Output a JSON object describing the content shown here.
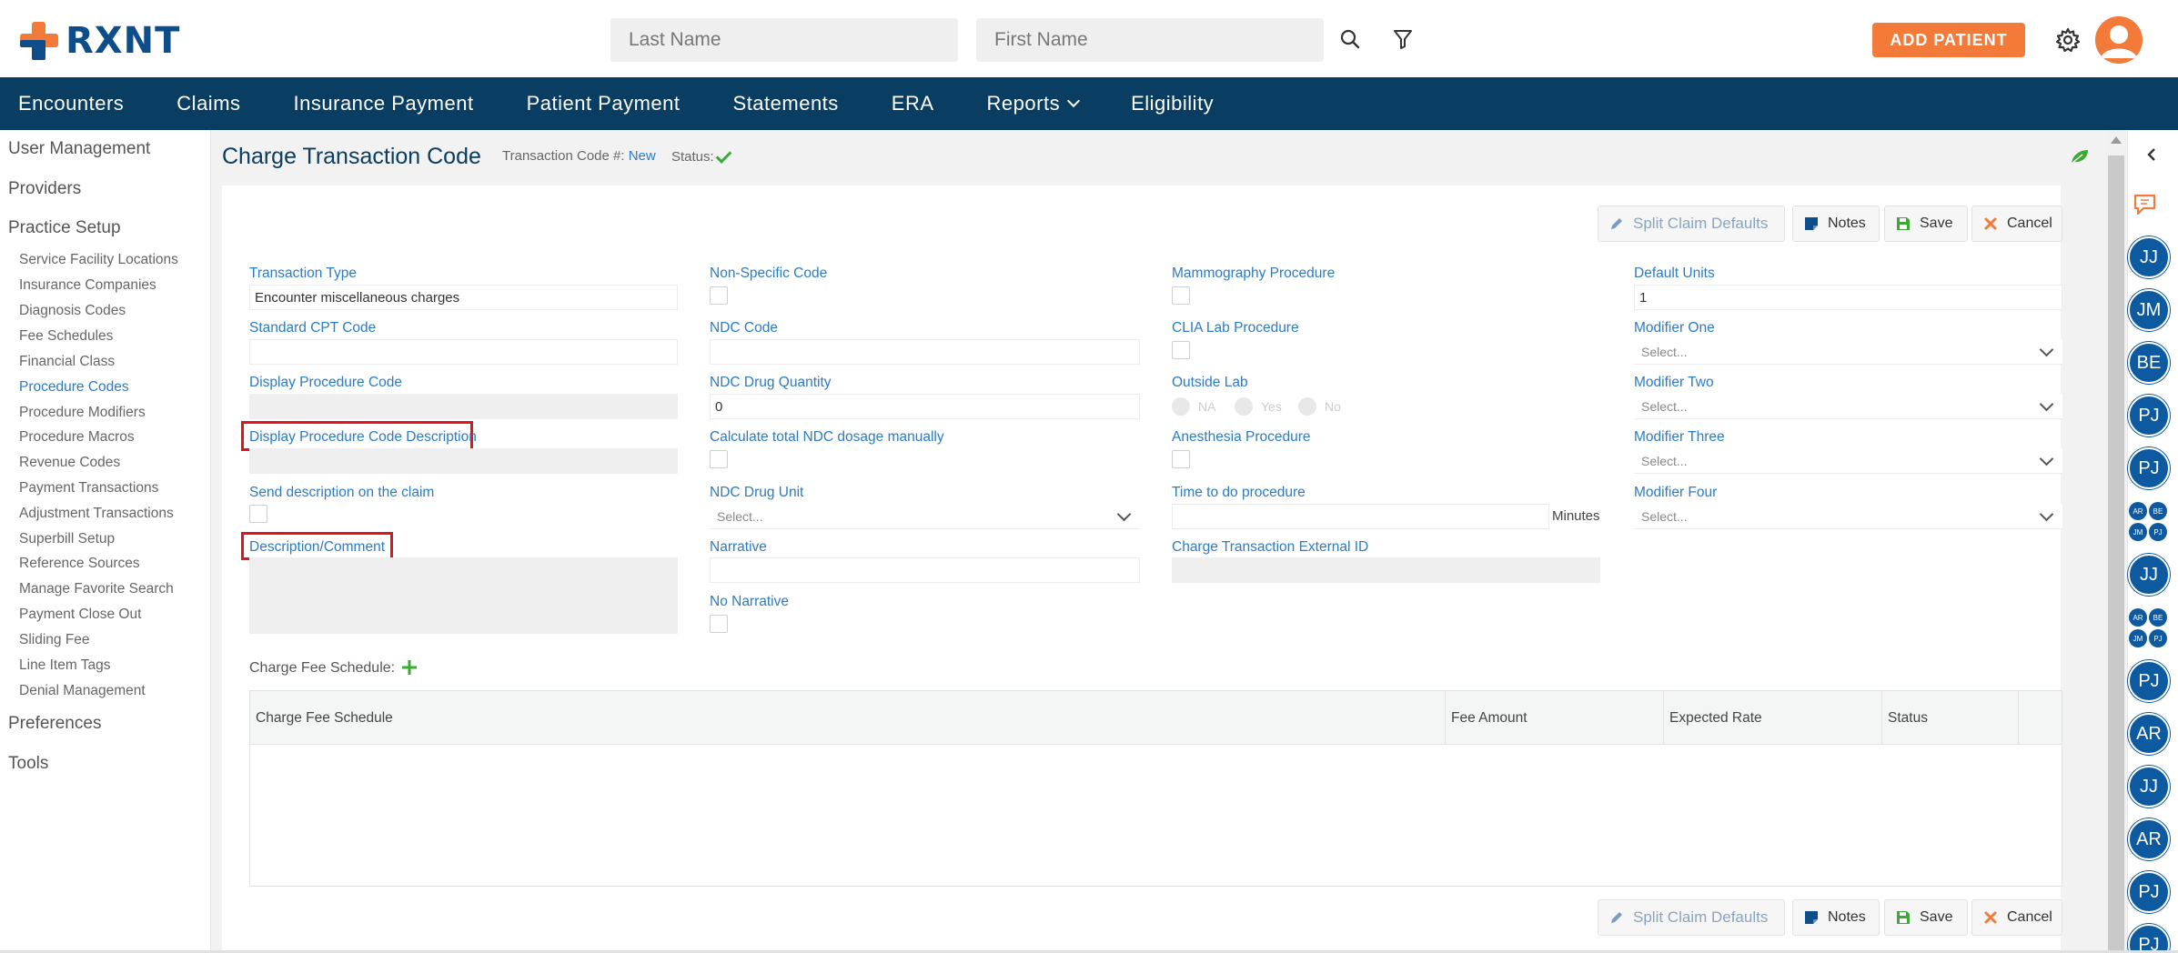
{
  "header": {
    "logo_text": "RXNT",
    "last_name_placeholder": "Last Name",
    "first_name_placeholder": "First Name",
    "add_patient_label": "ADD PATIENT"
  },
  "nav": {
    "items": [
      "Encounters",
      "Claims",
      "Insurance Payment",
      "Patient Payment",
      "Statements",
      "ERA",
      "Reports",
      "Eligibility"
    ]
  },
  "sidebar": {
    "sections": [
      "User Management",
      "Providers",
      "Practice Setup",
      "Preferences",
      "Tools"
    ],
    "practice_setup_items": [
      "Service Facility Locations",
      "Insurance Companies",
      "Diagnosis Codes",
      "Fee Schedules",
      "Financial Class",
      "Procedure Codes",
      "Procedure Modifiers",
      "Procedure Macros",
      "Revenue Codes",
      "Payment Transactions",
      "Adjustment Transactions",
      "Superbill Setup",
      "Reference Sources",
      "Manage Favorite Search",
      "Payment Close Out",
      "Sliding Fee",
      "Line Item Tags",
      "Denial Management"
    ]
  },
  "page": {
    "title": "Charge Transaction Code",
    "tc_label": "Transaction Code #:",
    "tc_value": "New",
    "status_label": "Status:"
  },
  "buttons": {
    "split": "Split Claim Defaults",
    "notes": "Notes",
    "save": "Save",
    "cancel": "Cancel"
  },
  "form": {
    "transaction_type_label": "Transaction Type",
    "transaction_type_value": "Encounter miscellaneous charges",
    "standard_cpt_label": "Standard CPT Code",
    "display_proc_code_label": "Display Procedure Code",
    "display_proc_desc_label": "Display Procedure Code Description",
    "send_desc_label": "Send description on the claim",
    "desc_comment_label": "Description/Comment",
    "non_specific_label": "Non-Specific Code",
    "ndc_code_label": "NDC Code",
    "ndc_qty_label": "NDC Drug Quantity",
    "ndc_qty_value": "0",
    "calc_ndc_label": "Calculate total NDC dosage manually",
    "ndc_unit_label": "NDC Drug Unit",
    "ndc_unit_placeholder": "Select...",
    "narrative_label": "Narrative",
    "no_narrative_label": "No Narrative",
    "mammo_label": "Mammography Procedure",
    "clia_label": "CLIA Lab Procedure",
    "outside_lab_label": "Outside Lab",
    "outside_lab_options": [
      "NA",
      "Yes",
      "No"
    ],
    "anesthesia_label": "Anesthesia Procedure",
    "time_label": "Time to do procedure",
    "minutes_label": "Minutes",
    "ext_id_label": "Charge Transaction External ID",
    "default_units_label": "Default Units",
    "default_units_value": "1",
    "modifier_one_label": "Modifier One",
    "modifier_two_label": "Modifier Two",
    "modifier_three_label": "Modifier Three",
    "modifier_four_label": "Modifier Four",
    "select_placeholder": "Select..."
  },
  "fee_schedule": {
    "label": "Charge Fee Schedule:",
    "columns": [
      "Charge Fee Schedule",
      "Fee Amount",
      "Expected Rate",
      "Status"
    ],
    "rows": []
  },
  "rail": {
    "circles": [
      "JJ",
      "JM",
      "BE",
      "PJ",
      "PJ",
      "JJ",
      "PJ",
      "AR",
      "JJ",
      "AR",
      "PJ",
      "PJ"
    ],
    "mini_group": [
      "AR",
      "BE",
      "JM",
      "PJ"
    ]
  },
  "colors": {
    "navy": "#0a3d62",
    "link_blue": "#2d7bc0",
    "orange": "#f47a3a",
    "rail_blue": "#0d5aa0",
    "highlight_red": "#e0141e",
    "check_green": "#3aaa35"
  }
}
